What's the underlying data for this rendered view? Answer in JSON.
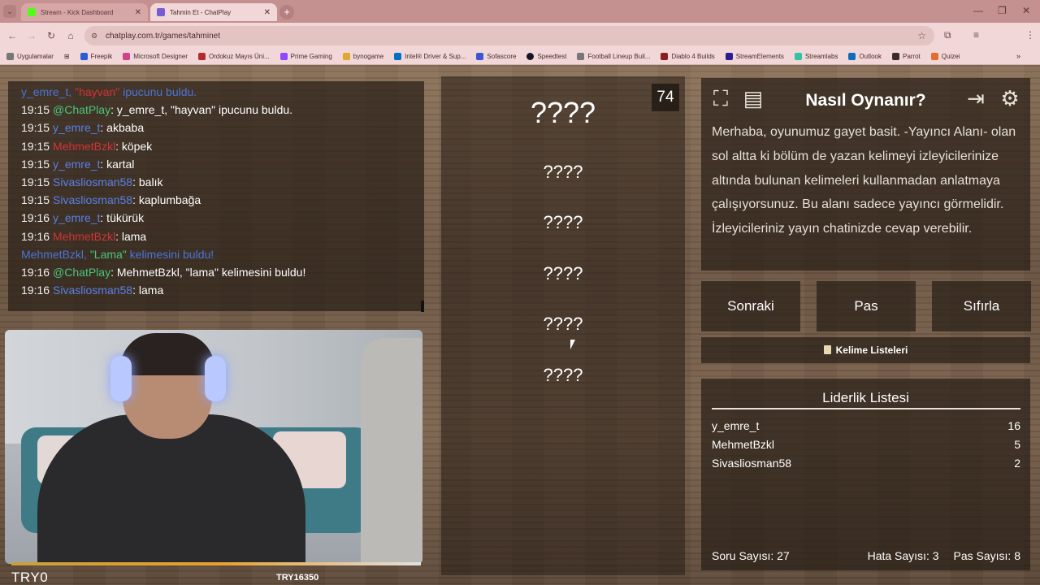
{
  "browser": {
    "tabs": [
      {
        "title": "Stream - Kick Dashboard",
        "favicon_color": "#53fc18"
      },
      {
        "title": "Tahmin Et - ChatPlay",
        "favicon_color": "#7a5bd6"
      }
    ],
    "url": "chatplay.com.tr/games/tahminet",
    "bookmarks": [
      {
        "label": "Uygulamalar",
        "color": "#777777"
      },
      {
        "label": "Freepik",
        "color": "#2d5bd8"
      },
      {
        "label": "Microsoft Designer",
        "color": "#d0428e"
      },
      {
        "label": "Ordokuz Mayıs Üni...",
        "color": "#b42b2b"
      },
      {
        "label": "Prime Gaming",
        "color": "#9146ff"
      },
      {
        "label": "bynogame",
        "color": "#e0a82e"
      },
      {
        "label": "Intel® Driver & Sup...",
        "color": "#0071c5"
      },
      {
        "label": "Sofascore",
        "color": "#3a56d4"
      },
      {
        "label": "Speedtest",
        "color": "#141526"
      },
      {
        "label": "Football Lineup Buil...",
        "color": "#777777"
      },
      {
        "label": "Diablo 4 Builds",
        "color": "#8a1e1e"
      },
      {
        "label": "StreamElements",
        "color": "#2b1e8f"
      },
      {
        "label": "Streamlabs",
        "color": "#31c3a2"
      },
      {
        "label": "Outlook",
        "color": "#0f6cbd"
      },
      {
        "label": "Parrot",
        "color": "#3c2b2b"
      },
      {
        "label": "Quizei",
        "color": "#e56b2e"
      }
    ]
  },
  "chat": {
    "messages": [
      {
        "time": "",
        "user": "y_emre_t, ",
        "user_color": "sys",
        "text": "ipucunu buldu.",
        "extra": "\"hayvan\" ",
        "system": true
      },
      {
        "time": "19:15",
        "user": "@ChatPlay",
        "user_color": "u-green",
        "text": ": y_emre_t, \"hayvan\" ipucunu buldu."
      },
      {
        "time": "19:15",
        "user": "y_emre_t",
        "user_color": "u-blue",
        "text": ": akbaba"
      },
      {
        "time": "19:15",
        "user": "MehmetBzkl",
        "user_color": "u-red",
        "text": ": köpek"
      },
      {
        "time": "19:15",
        "user": "y_emre_t",
        "user_color": "u-blue",
        "text": ": kartal"
      },
      {
        "time": "19:15",
        "user": "Sivasliosman58",
        "user_color": "u-blue",
        "text": ": balık"
      },
      {
        "time": "19:15",
        "user": "Sivasliosman58",
        "user_color": "u-blue",
        "text": ": kaplumbağa"
      },
      {
        "time": "19:16",
        "user": "y_emre_t",
        "user_color": "u-blue",
        "text": ": tükürük"
      },
      {
        "time": "19:16",
        "user": "MehmetBzkl",
        "user_color": "u-red",
        "text": ": lama"
      },
      {
        "time": "",
        "user": "MehmetBzkl, ",
        "user_color": "sys",
        "text": " kelimesini buldu!",
        "extra": "\"Lama\"",
        "system": true
      },
      {
        "time": "19:16",
        "user": "@ChatPlay",
        "user_color": "u-green",
        "text": ": MehmetBzkl, \"lama\" kelimesini buldu!"
      },
      {
        "time": "19:16",
        "user": "Sivasliosman58",
        "user_color": "u-blue",
        "text": ": lama"
      }
    ]
  },
  "camera": {
    "left_label": "TRY0",
    "right_label": "TRY16350"
  },
  "words": {
    "timer": "74",
    "items": [
      "????",
      "????",
      "????",
      "????",
      "????",
      "????"
    ]
  },
  "how_to": {
    "title": "Nasıl Oynanır?",
    "text": "Merhaba, oyunumuz gayet basit. -Yayıncı Alanı- olan sol altta ki bölüm de yazan kelimeyi izleyicilerinize altında bulunan kelimeleri kullanmadan anlatmaya çalışıyorsunuz. Bu alanı sadece yayıncı görmelidir. İzleyicileriniz yayın chatinizde cevap verebilir."
  },
  "controls": {
    "next": "Sonraki",
    "pass": "Pas",
    "reset": "Sıfırla",
    "word_lists": "Kelime Listeleri"
  },
  "leaderboard": {
    "title": "Liderlik Listesi",
    "rows": [
      {
        "name": "y_emre_t",
        "score": "16"
      },
      {
        "name": "MehmetBzkl",
        "score": "5"
      },
      {
        "name": "Sivasliosman58",
        "score": "2"
      }
    ],
    "question_count": "Soru Sayısı: 27",
    "error_count": "Hata Sayısı: 3",
    "pass_count": "Pas Sayısı: 8"
  }
}
